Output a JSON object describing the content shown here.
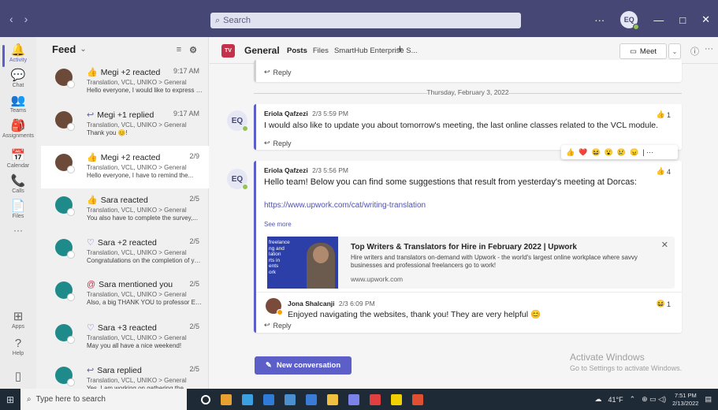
{
  "titlebar": {
    "back": "‹",
    "forward": "›",
    "search_placeholder": "Search",
    "more": "···",
    "user_initials": "EQ",
    "minimize": "—",
    "maximize": "□",
    "close": "✕"
  },
  "rail": [
    {
      "label": "Activity",
      "icon": "🔔"
    },
    {
      "label": "Chat",
      "icon": "💬"
    },
    {
      "label": "Teams",
      "icon": "👥"
    },
    {
      "label": "Assignments",
      "icon": "🎒"
    },
    {
      "label": "Calendar",
      "icon": "📅"
    },
    {
      "label": "Calls",
      "icon": "📞"
    },
    {
      "label": "Files",
      "icon": "📄"
    },
    {
      "label": "···",
      "icon": ""
    },
    {
      "label": "Apps",
      "icon": "⊞"
    },
    {
      "label": "Help",
      "icon": "?"
    }
  ],
  "feed": {
    "title": "Feed",
    "items": [
      {
        "kind": "reacted",
        "title": "Megi +2 reacted",
        "time": "9:17 AM",
        "sub": "Translation, VCL, UNIKO > General",
        "preview": "Hello everyone, I would like to express my..."
      },
      {
        "kind": "replied",
        "title": "Megi +1 replied",
        "time": "9:17 AM",
        "sub": "Translation, VCL, UNIKO > General",
        "preview": "Thank you 😊!"
      },
      {
        "kind": "reacted",
        "title": "Megi +2 reacted",
        "time": "2/9",
        "sub": "Translation, VCL, UNIKO > General",
        "preview": "Hello everyone, I have to remind the..."
      },
      {
        "kind": "reacted",
        "title": "Sara reacted",
        "time": "2/5",
        "sub": "Translation, VCL, UNIKO > General",
        "preview": "You also have to complete the survey,..."
      },
      {
        "kind": "heart",
        "title": "Sara +2 reacted",
        "time": "2/5",
        "sub": "Translation, VCL, UNIKO > General",
        "preview": "Congratulations on the completion of you..."
      },
      {
        "kind": "mention",
        "title": "Sara mentioned you",
        "time": "2/5",
        "sub": "Translation, VCL, UNIKO > General",
        "preview": "Also, a big THANK YOU to professor Eriol..."
      },
      {
        "kind": "heart",
        "title": "Sara +3 reacted",
        "time": "2/5",
        "sub": "Translation, VCL, UNIKO > General",
        "preview": "May you all have a nice weekend!"
      },
      {
        "kind": "replied",
        "title": "Sara replied",
        "time": "2/5",
        "sub": "Translation, VCL, UNIKO > General",
        "preview": "Yes, I am working on gathering the..."
      }
    ]
  },
  "channel": {
    "badge": "TV",
    "name": "General",
    "tabs": [
      "Posts",
      "Files",
      "SmartHub Enterprise S..."
    ],
    "add": "+",
    "meet": "Meet",
    "info": "ⓘ",
    "more": "···"
  },
  "conversation": {
    "reply_label": "Reply",
    "date_separator": "Thursday, February 3, 2022",
    "post1": {
      "initials": "EQ",
      "author": "Eriola Qafzezi",
      "time": "2/3 5:59 PM",
      "body": "I would also like to update you about tomorrow's meeting, the last online classes related to the VCL module.",
      "reaction": "👍",
      "reaction_count": "1"
    },
    "reaction_bar": [
      "👍",
      "❤️",
      "😆",
      "😮",
      "😢",
      "😠"
    ],
    "post2": {
      "initials": "EQ",
      "author": "Eriola Qafzezi",
      "time": "2/3 5:56 PM",
      "body": "Hello team! Below you can find some suggestions that result from yesterday's meeting at Dorcas:",
      "link": "https://www.upwork.com/cat/writing-translation",
      "see_more": "See more",
      "reaction": "👍",
      "reaction_count": "4",
      "preview_title": "Top Writers & Translators for Hire in February 2022 | Upwork",
      "preview_desc": "Hire writers and translators on-demand with Upwork - the world's largest online workplace where savvy businesses and professional freelancers go to work!",
      "preview_url": "www.upwork.com",
      "thumb_text": "freelance\nng and\nlation\nrts in\nents\nork"
    },
    "reply1": {
      "author": "Jona Shalcanji",
      "time": "2/3 6:09 PM",
      "body": "Enjoyed navigating the websites, thank you! They are very helpful 😊",
      "reaction": "😆",
      "reaction_count": "1"
    },
    "new_conversation": "New conversation",
    "watermark_title": "Activate Windows",
    "watermark_sub": "Go to Settings to activate Windows."
  },
  "taskbar": {
    "search_placeholder": "Type here to search",
    "weather": "41°F",
    "time": "7:51 PM",
    "date": "2/13/2022",
    "app_colors": [
      "#ffffff",
      "#e8a030",
      "#3aa0e0",
      "#2f7bd8",
      "#4a90d0",
      "#3a7bd5",
      "#f0c040",
      "#7b83eb",
      "#e04040",
      "#f0d000",
      "#e05030"
    ]
  }
}
